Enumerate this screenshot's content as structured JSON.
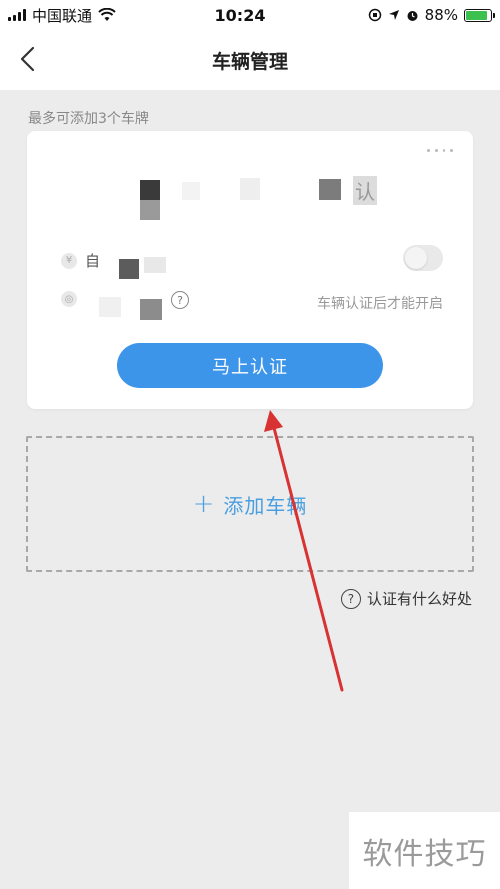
{
  "status_bar": {
    "carrier": "中国联通",
    "time": "10:24",
    "battery": "88%",
    "battery_level": 0.88
  },
  "nav": {
    "title": "车辆管理"
  },
  "hint": "最多可添加3个车牌",
  "card": {
    "partial_text": "认",
    "row1_label": "自",
    "note": "车辆认证后才能开启",
    "verify_button": "马上认证",
    "toggle_on": false
  },
  "add_vehicle": {
    "plus": "+",
    "label": "添加车辆"
  },
  "benefit_link": "认证有什么好处",
  "watermark": "软件技巧",
  "colors": {
    "accent": "#3d95e9",
    "link": "#4a9fe0",
    "arrow": "#d83232"
  }
}
